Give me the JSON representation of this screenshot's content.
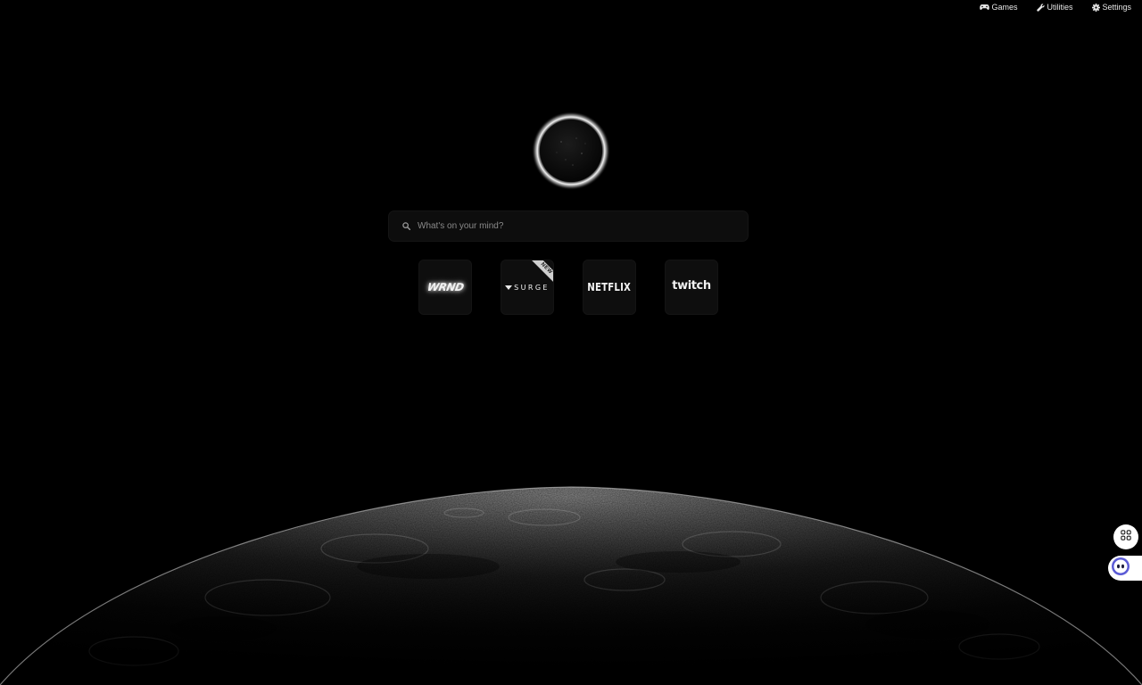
{
  "topnav": {
    "games": {
      "label": "Games",
      "icon": "gamepad-icon"
    },
    "utilities": {
      "label": "Utilities",
      "icon": "wrench-icon"
    },
    "settings": {
      "label": "Settings",
      "icon": "gear-icon"
    }
  },
  "logo": {
    "icon": "eclipse-logo-icon"
  },
  "search": {
    "placeholder": "What's on your mind?",
    "value": "",
    "icon": "search-icon"
  },
  "shortcuts": [
    {
      "id": "wrnd",
      "label": "WRND"
    },
    {
      "id": "surge",
      "label": "SURGE",
      "badge": "NEW"
    },
    {
      "id": "netflix",
      "label": "NETFLIX"
    },
    {
      "id": "twitch",
      "label": "twitch"
    }
  ],
  "floating": {
    "apps_icon": "apps-grid-icon",
    "chat_icon": "chat-bot-icon"
  },
  "colors": {
    "background": "#000000",
    "surface": "#0e0e0e",
    "text": "#e6e6e6",
    "chat_accent": "#5b5bd6"
  }
}
